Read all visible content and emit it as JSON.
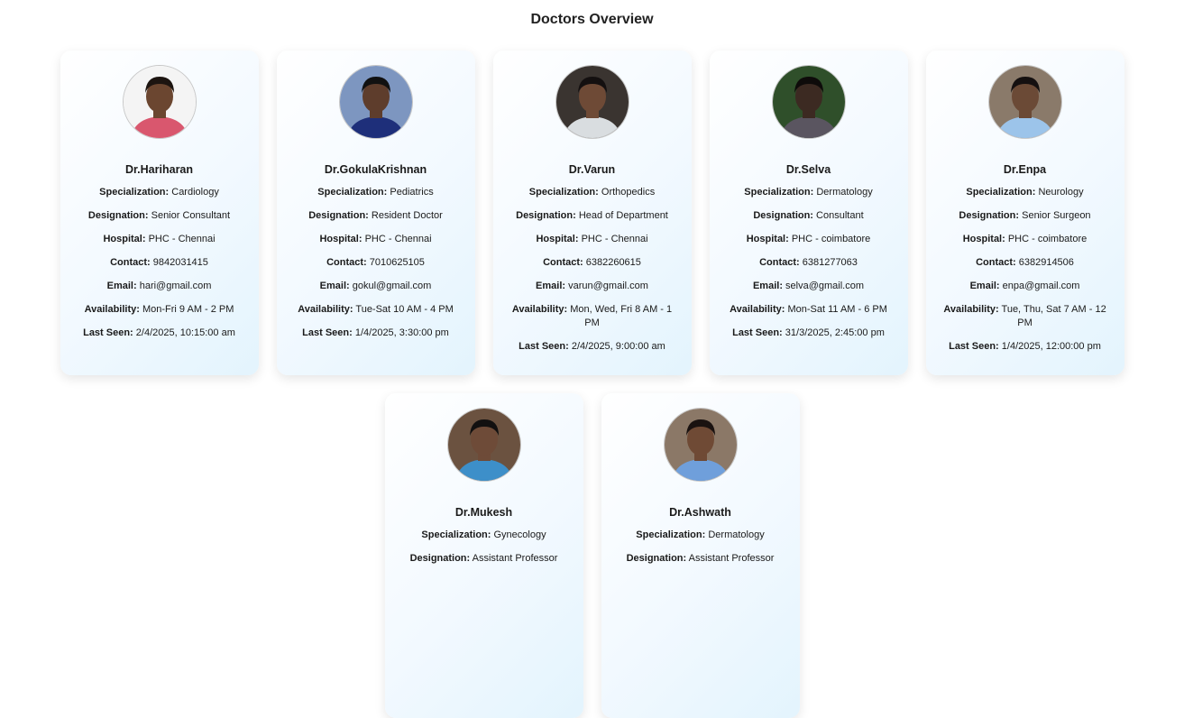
{
  "page": {
    "title": "Doctors Overview"
  },
  "labels": {
    "specialization": "Specialization:",
    "designation": "Designation:",
    "hospital": "Hospital:",
    "contact": "Contact:",
    "email": "Email:",
    "availability": "Availability:",
    "last_seen": "Last Seen:"
  },
  "doctors": [
    {
      "name": "Dr.Hariharan",
      "specialization": "Cardiology",
      "designation": "Senior Consultant",
      "hospital": "PHC - Chennai",
      "contact": "9842031415",
      "email": "hari@gmail.com",
      "availability": "Mon-Fri 9 AM - 2 PM",
      "last_seen": "2/4/2025, 10:15:00 am",
      "avatar": {
        "bg": "#f4f4f4",
        "skin": "#6b4630",
        "hair": "#1c1410",
        "shirt": "#d9576e"
      }
    },
    {
      "name": "Dr.GokulaKrishnan",
      "specialization": "Pediatrics",
      "designation": "Resident Doctor",
      "hospital": "PHC - Chennai",
      "contact": "7010625105",
      "email": "gokul@gmail.com",
      "availability": "Tue-Sat 10 AM - 4 PM",
      "last_seen": "1/4/2025, 3:30:00 pm",
      "avatar": {
        "bg": "#7d96c0",
        "skin": "#5e3d2c",
        "hair": "#111111",
        "shirt": "#1e2f7a"
      }
    },
    {
      "name": "Dr.Varun",
      "specialization": "Orthopedics",
      "designation": "Head of Department",
      "hospital": "PHC - Chennai",
      "contact": "6382260615",
      "email": "varun@gmail.com",
      "availability": "Mon, Wed, Fri 8 AM - 1 PM",
      "last_seen": "2/4/2025, 9:00:00 am",
      "avatar": {
        "bg": "#3a3430",
        "skin": "#6e4a36",
        "hair": "#141010",
        "shirt": "#d9dde0"
      }
    },
    {
      "name": "Dr.Selva",
      "specialization": "Dermatology",
      "designation": "Consultant",
      "hospital": "PHC - coimbatore",
      "contact": "6381277063",
      "email": "selva@gmail.com",
      "availability": "Mon-Sat 11 AM - 6 PM",
      "last_seen": "31/3/2025, 2:45:00 pm",
      "avatar": {
        "bg": "#2f4f2a",
        "skin": "#3c2a22",
        "hair": "#0e0b0a",
        "shirt": "#5a5560"
      }
    },
    {
      "name": "Dr.Enpa",
      "specialization": "Neurology",
      "designation": "Senior Surgeon",
      "hospital": "PHC - coimbatore",
      "contact": "6382914506",
      "email": "enpa@gmail.com",
      "availability": "Tue, Thu, Sat 7 AM - 12 PM",
      "last_seen": "1/4/2025, 12:00:00 pm",
      "avatar": {
        "bg": "#8a7a6a",
        "skin": "#6b4a36",
        "hair": "#151010",
        "shirt": "#9cc4ea"
      }
    },
    {
      "name": "Dr.Mukesh",
      "specialization": "Gynecology",
      "designation": "Assistant Professor",
      "avatar": {
        "bg": "#6b5240",
        "skin": "#6e4b38",
        "hair": "#121010",
        "shirt": "#3d8fc9"
      }
    },
    {
      "name": "Dr.Ashwath",
      "specialization": "Dermatology",
      "designation": "Assistant Professor",
      "avatar": {
        "bg": "#8b7867",
        "skin": "#6f4a35",
        "hair": "#1a1210",
        "shirt": "#6f9fdb"
      }
    }
  ]
}
